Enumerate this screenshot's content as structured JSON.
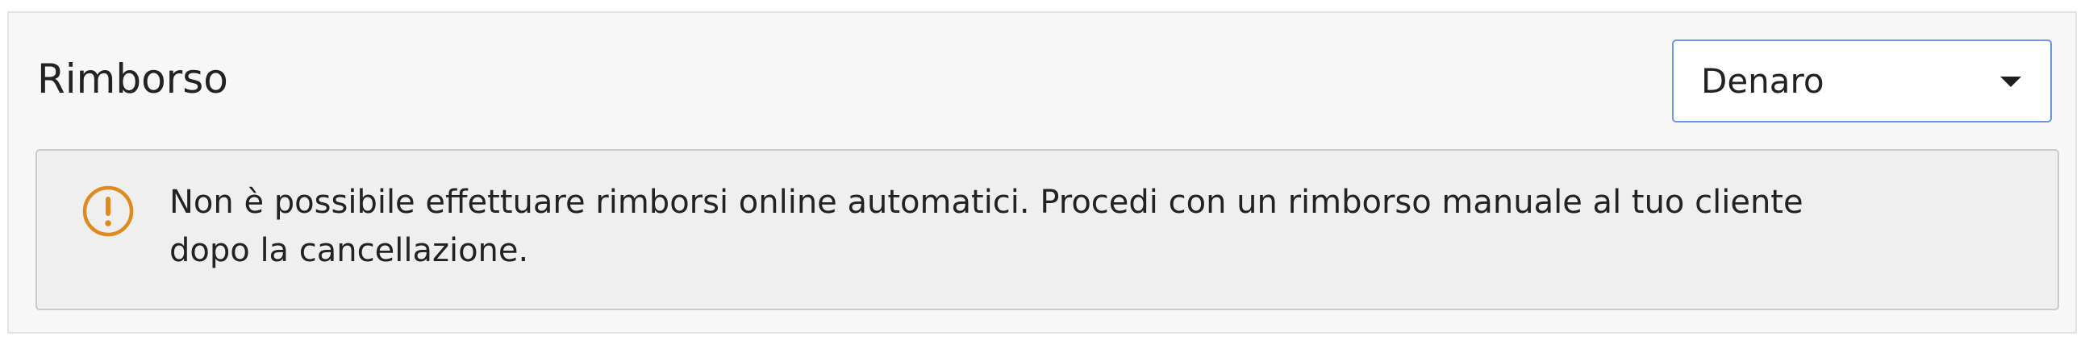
{
  "refund_section": {
    "title": "Rimborso",
    "method_select": {
      "selected": "Denaro"
    },
    "notice": {
      "icon": "warning-circle-icon",
      "icon_color": "#e08a1e",
      "line1": "Non è possibile effettuare rimborsi online automatici. Procedi con un rimborso manuale al tuo cliente",
      "line2": "dopo la cancellazione."
    }
  }
}
